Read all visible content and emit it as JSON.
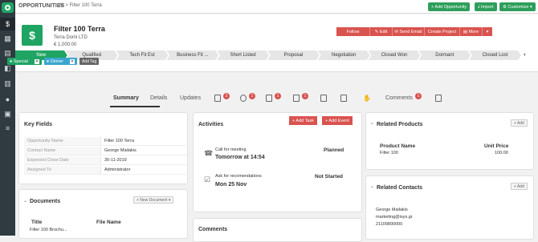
{
  "topbar": {
    "module": "OPPORTUNITIES",
    "breadcrumb": "All > Filter 100 Terra",
    "add_label": "+ Add Opportunity",
    "import_label": "Import",
    "customize_label": "Customize ▾"
  },
  "record": {
    "name": "Filter 100 Terra",
    "account": "Terra Domi LTD",
    "amount": "€ 1,000.00"
  },
  "actions": [
    "Follow",
    "Edit",
    "Send Email",
    "Create Project",
    "More",
    "▾"
  ],
  "stages": [
    "New",
    "Qualified",
    "Tech Fit Est",
    "Business Fit ...",
    "Short Listed",
    "Proposal",
    "Negotiation",
    "Closed Won",
    "Dormant",
    "Closed Lost"
  ],
  "tags": [
    {
      "label": "Special",
      "color": "#1fa463"
    },
    {
      "label": "Dinner",
      "color": "#3aa6d0"
    }
  ],
  "add_tag": "Add Tag",
  "tabs": {
    "summary": "Summary",
    "details": "Details",
    "updates": "Updates",
    "comments": "Comments",
    "badges": {
      "calendar": "2",
      "contacts": "1",
      "products": "1",
      "docs": "1",
      "comments": "1"
    }
  },
  "key_fields": {
    "title": "Key Fields",
    "rows": [
      {
        "k": "Opportunity Name",
        "v": "Filter 100 Terra"
      },
      {
        "k": "Contact Name",
        "v": "George Mailakis"
      },
      {
        "k": "Expected Close Date",
        "v": "30-11-2019"
      },
      {
        "k": "Assigned To",
        "v": "Administrator"
      }
    ]
  },
  "documents": {
    "title": "Documents",
    "new_label": "+ New Document ▾",
    "col_title": "Title",
    "col_file": "File Name",
    "row_title": "Filter 100 Brochu..."
  },
  "activities": {
    "title": "Activities",
    "add_task": "+ Add Task",
    "add_event": "+ Add Event",
    "items": [
      {
        "name": "Call for meeting",
        "when": "Tomorrow at 14:54",
        "status": "Planned"
      },
      {
        "name": "Ask for recomendations",
        "when": "Mon 25 Nov",
        "status": "Not Started"
      }
    ]
  },
  "comments_card": {
    "title": "Comments"
  },
  "related_products": {
    "title": "Related Products",
    "add": "+ Add",
    "col_name": "Product Name",
    "col_price": "Unit Price",
    "row_name": "Filter 100",
    "row_price": "100.00"
  },
  "related_contacts": {
    "title": "Related Contacts",
    "add": "+ Add",
    "name": "George Mailakis",
    "email": "marketing@isys.gr",
    "phone": "21109890000"
  }
}
